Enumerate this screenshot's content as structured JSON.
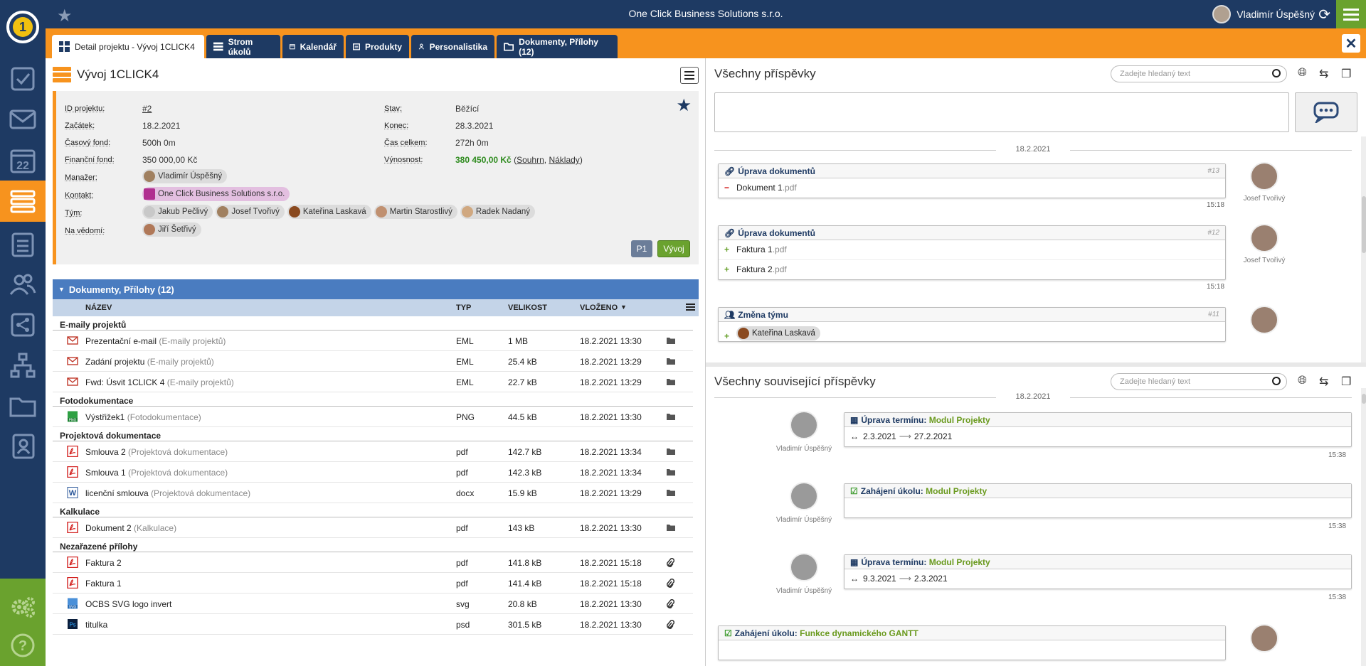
{
  "topbar": {
    "company": "One Click Business Solutions s.r.o.",
    "user": "Vladimír Úspěšný"
  },
  "tabs": [
    {
      "label": "Detail projektu - Vývoj 1CLICK4"
    },
    {
      "label": "Strom úkolů"
    },
    {
      "label": "Kalendář"
    },
    {
      "label": "Produkty"
    },
    {
      "label": "Personalistika"
    },
    {
      "label": "Dokumenty, Přílohy (12)"
    }
  ],
  "sidebar": [
    "checklist",
    "mail",
    "calendar-22",
    "projects",
    "clipboard",
    "people",
    "share",
    "org-chart",
    "folder",
    "contacts"
  ],
  "calendar_day": "22",
  "project": {
    "title": "Vývoj 1CLICK4",
    "labels": {
      "id": "ID projektu:",
      "start": "Začátek:",
      "timefund": "Časový fond:",
      "finfund": "Finanční fond:",
      "manager": "Manažer:",
      "contact": "Kontakt:",
      "team": "Tým:",
      "cc": "Na vědomí:",
      "state": "Stav:",
      "end": "Konec:",
      "total": "Čas celkem:",
      "yield": "Výnosnost:"
    },
    "id": "#2",
    "start": "18.2.2021",
    "timefund": "500h 0m",
    "finfund": "350 000,00 Kč",
    "state": "Běžící",
    "end": "28.3.2021",
    "total": "272h 0m",
    "yield_value": "380 450,00 Kč",
    "yield_open": "(",
    "yield_link1": "Souhrn",
    "yield_sep": ", ",
    "yield_link2": "Náklady",
    "yield_close": ")",
    "manager": "Vladimír Úspěšný",
    "contact": "One Click Business Solutions s.r.o.",
    "team": [
      "Jakub Pečlivý",
      "Josef Tvořivý",
      "Kateřina Laskavá",
      "Martin Starostlivý",
      "Radek Nadaný"
    ],
    "cc": "Jiří Šetřivý",
    "badge_p1": "P1",
    "badge_phase": "Vývoj"
  },
  "documents": {
    "header": "Dokumenty, Přílohy (12)",
    "columns": {
      "name": "NÁZEV",
      "type": "TYP",
      "size": "VELIKOST",
      "date": "VLOŽENO"
    },
    "groups": [
      {
        "name": "E-maily projektů",
        "rows": [
          {
            "icon": "mail-icon",
            "name": "Prezentační e-mail",
            "cat": "(E-maily projektů)",
            "type": "EML",
            "size": "1 MB",
            "date": "18.2.2021 13:30",
            "action": "folder"
          },
          {
            "icon": "mail-icon",
            "name": "Zadání projektu",
            "cat": "(E-maily projektů)",
            "type": "EML",
            "size": "25.4 kB",
            "date": "18.2.2021 13:29",
            "action": "folder"
          },
          {
            "icon": "mail-icon",
            "name": "Fwd: Úsvit 1CLICK 4",
            "cat": "(E-maily projektů)",
            "type": "EML",
            "size": "22.7 kB",
            "date": "18.2.2021 13:29",
            "action": "folder"
          }
        ]
      },
      {
        "name": "Fotodokumentace",
        "rows": [
          {
            "icon": "png-icon",
            "name": "Výstřižek1",
            "cat": "(Fotodokumentace)",
            "type": "PNG",
            "size": "44.5 kB",
            "date": "18.2.2021 13:30",
            "action": "folder"
          }
        ]
      },
      {
        "name": "Projektová dokumentace",
        "rows": [
          {
            "icon": "pdf-icon",
            "name": "Smlouva 2",
            "cat": "(Projektová dokumentace)",
            "type": "pdf",
            "size": "142.7 kB",
            "date": "18.2.2021 13:34",
            "action": "folder"
          },
          {
            "icon": "pdf-icon",
            "name": "Smlouva 1",
            "cat": "(Projektová dokumentace)",
            "type": "pdf",
            "size": "142.3 kB",
            "date": "18.2.2021 13:34",
            "action": "folder"
          },
          {
            "icon": "word-icon",
            "name": "licenční smlouva",
            "cat": "(Projektová dokumentace)",
            "type": "docx",
            "size": "15.9 kB",
            "date": "18.2.2021 13:29",
            "action": "folder"
          }
        ]
      },
      {
        "name": "Kalkulace",
        "rows": [
          {
            "icon": "pdf-icon",
            "name": "Dokument 2",
            "cat": "(Kalkulace)",
            "type": "pdf",
            "size": "143 kB",
            "date": "18.2.2021 13:30",
            "action": "folder"
          }
        ]
      },
      {
        "name": "Nezařazené přílohy",
        "rows": [
          {
            "icon": "pdf-icon",
            "name": "Faktura 2",
            "cat": "",
            "type": "pdf",
            "size": "141.8 kB",
            "date": "18.2.2021 15:18",
            "action": "clip"
          },
          {
            "icon": "pdf-icon",
            "name": "Faktura 1",
            "cat": "",
            "type": "pdf",
            "size": "141.4 kB",
            "date": "18.2.2021 15:18",
            "action": "clip"
          },
          {
            "icon": "svg-icon",
            "name": "OCBS SVG logo invert",
            "cat": "",
            "type": "svg",
            "size": "20.8 kB",
            "date": "18.2.2021 13:30",
            "action": "clip"
          },
          {
            "icon": "psd-icon",
            "name": "titulka",
            "cat": "",
            "type": "psd",
            "size": "301.5 kB",
            "date": "18.2.2021 13:30",
            "action": "clip"
          }
        ]
      }
    ]
  },
  "posts": {
    "title": "Všechny příspěvky",
    "search_placeholder": "Zadejte hledaný text",
    "date": "18.2.2021",
    "items": [
      {
        "title": "Úprava dokumentů",
        "num": "#13",
        "lines": [
          {
            "sign": "−",
            "name": "Dokument 1",
            "ext": ".pdf"
          }
        ],
        "time": "15:18",
        "author": "Josef Tvořivý"
      },
      {
        "title": "Úprava dokumentů",
        "num": "#12",
        "lines": [
          {
            "sign": "+",
            "name": "Faktura 1",
            "ext": ".pdf"
          },
          {
            "sign": "+",
            "name": "Faktura 2",
            "ext": ".pdf"
          }
        ],
        "time": "15:18",
        "author": "Josef Tvořivý"
      },
      {
        "title": "Změna týmu",
        "num": "#11",
        "lines": [
          {
            "sign": "+",
            "name": "Kateřina Laskavá",
            "ext": ""
          }
        ],
        "time": "",
        "author": ""
      }
    ]
  },
  "related": {
    "title": "Všechny související příspěvky",
    "search_placeholder": "Zadejte hledaný text",
    "date": "18.2.2021",
    "items": [
      {
        "title": "Úprava termínu:",
        "link": "Modul Projekty",
        "line_from": "2.3.2021",
        "line_to": "27.2.2021",
        "time": "15:38",
        "author": "Vladimír Úspěšný"
      },
      {
        "title": "Zahájení úkolu:",
        "link": "Modul Projekty",
        "line_from": "",
        "line_to": "",
        "time": "15:38",
        "author": "Vladimír Úspěšný"
      },
      {
        "title": "Úprava termínu:",
        "link": "Modul Projekty",
        "line_from": "9.3.2021",
        "line_to": "2.3.2021",
        "time": "15:38",
        "author": "Vladimír Úspěšný"
      },
      {
        "title": "Zahájení úkolu:",
        "link": "Funkce dynamického GANTT",
        "line_from": "",
        "line_to": "",
        "time": "",
        "author": ""
      }
    ]
  }
}
